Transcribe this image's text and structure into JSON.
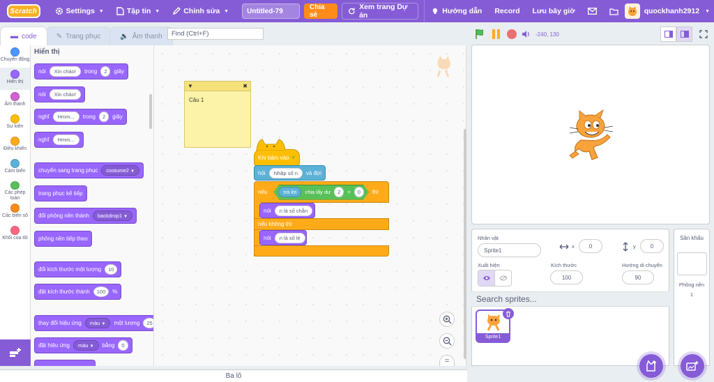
{
  "menu": {
    "logo": "Scratch",
    "settings": "Settings",
    "file": "Tập tin",
    "edit": "Chỉnh sửa",
    "project_title": "Untitled-79",
    "share": "Chia sẻ",
    "see_project": "Xem trang Dự án",
    "tutorials": "Hướng dẫn",
    "record": "Record",
    "save_now": "Lưu bây giờ",
    "username": "quockhanh2912"
  },
  "tabs": {
    "code": "code",
    "costumes": "Trang phục",
    "sounds": "Âm thanh"
  },
  "find": {
    "placeholder": "Find (Ctrl+F)"
  },
  "stage_header": {
    "coordinates": "-240, 130"
  },
  "categories": [
    {
      "label": "Chuyển động",
      "color": "#4c97ff"
    },
    {
      "label": "Hiển thị",
      "color": "#9966ff"
    },
    {
      "label": "Âm thanh",
      "color": "#cf63cf"
    },
    {
      "label": "Sự kiện",
      "color": "#ffbf00"
    },
    {
      "label": "Điều khiển",
      "color": "#ffab19"
    },
    {
      "label": "Cảm biến",
      "color": "#5cb1d6"
    },
    {
      "label": "Các phép toán",
      "color": "#59c059"
    },
    {
      "label": "Các biến số",
      "color": "#ff8c1a"
    },
    {
      "label": "Khối của tôi",
      "color": "#ff6680"
    }
  ],
  "palette": {
    "title": "Hiển thị",
    "b1": {
      "say": "nói",
      "msg": "Xin chào!",
      "for": "trong",
      "n": "2",
      "secs": "giây"
    },
    "b2": {
      "say": "nói",
      "msg": "Xin chào!"
    },
    "b3": {
      "think": "nghĩ",
      "msg": "Hmm...",
      "for": "trong",
      "n": "2",
      "secs": "giây"
    },
    "b4": {
      "think": "nghĩ",
      "msg": "Hmm..."
    },
    "b5": {
      "label": "chuyển sang trang phục",
      "value": "costume2"
    },
    "b6": {
      "label": "trang phục kế tiếp"
    },
    "b7": {
      "label": "đổi phông nền thành",
      "value": "backdrop1"
    },
    "b8": {
      "label": "phông nền tiếp theo"
    },
    "b9": {
      "label": "đổi kích thước một lượng",
      "value": "10"
    },
    "b10": {
      "label": "đặt kích thước thành",
      "value": "100",
      "unit": "%"
    },
    "b11": {
      "label": "thay đổi hiệu ứng",
      "effect": "màu",
      "by": "một lượng",
      "value": "25"
    },
    "b12": {
      "label": "đặt hiệu ứng",
      "effect": "màu",
      "to": "bằng",
      "value": "0"
    }
  },
  "note": {
    "text": "Câu 1"
  },
  "script": {
    "hat": "Khi bấm vào",
    "ask": "hỏi",
    "ask_text": "Nhập số n",
    "ask_wait": "và đợi",
    "if": "nếu",
    "answer": "trả lời",
    "mod": "chia lấy dư",
    "mod_n": "2",
    "eq": "=",
    "eq_v": "0",
    "then": "thì",
    "say1": "nói",
    "say1_text": "n là số chẵn",
    "else": "nếu không thì",
    "say2": "nói",
    "say2_text": "n là số lẻ"
  },
  "sprite_info": {
    "sprite_label": "Nhân vật",
    "sprite_name": "Sprite1",
    "x_label": "x",
    "x_value": "0",
    "y_label": "y",
    "y_value": "0",
    "show_label": "Xuất hiện",
    "size_label": "Kích thước",
    "size_value": "100",
    "direction_label": "Hướng di chuyển",
    "direction_value": "90"
  },
  "sprite_list": {
    "search_placeholder": "Search sprites...",
    "items": [
      {
        "name": "Sprite1"
      }
    ]
  },
  "stage_pane": {
    "title": "Sân khấu",
    "backdrops_label": "Phông nền",
    "backdrops_count": "1"
  },
  "backpack": {
    "label": "Ba lô"
  },
  "colors": {
    "accent": "#855cd6",
    "orange": "#ff8c1a",
    "looks": "#9966ff"
  }
}
